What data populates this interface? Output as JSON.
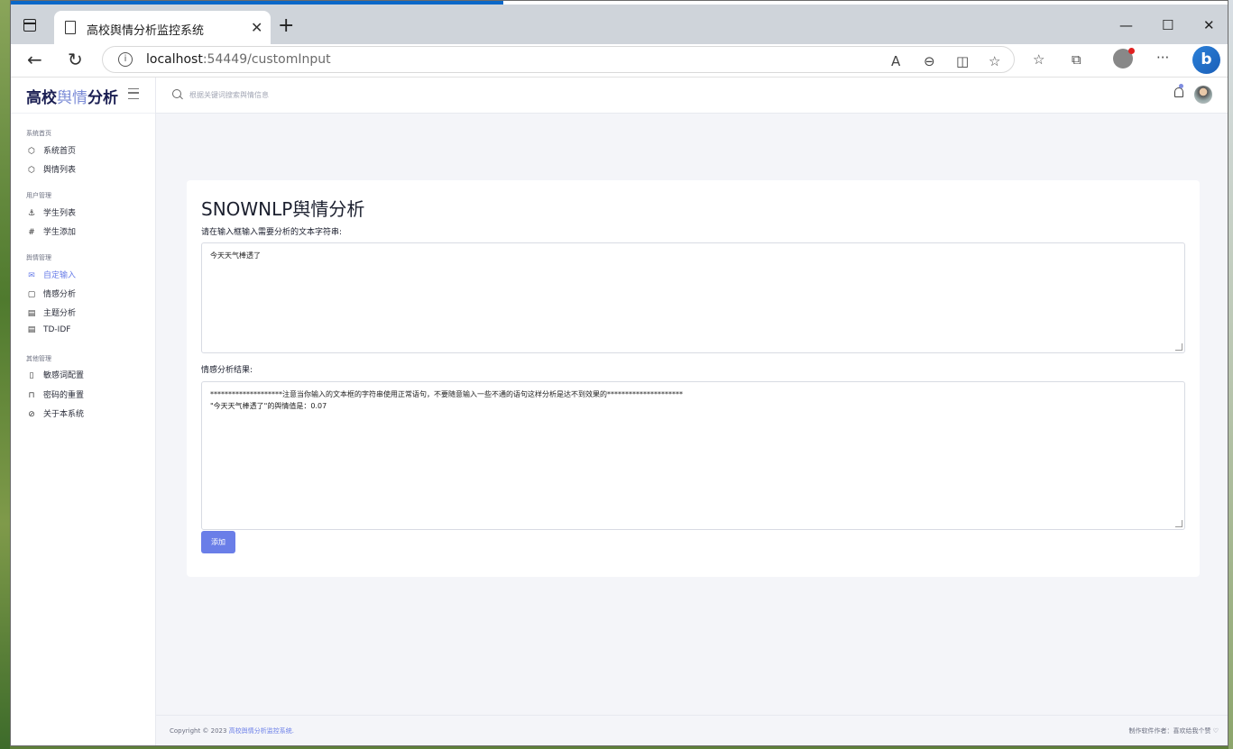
{
  "browser": {
    "tab_title": "高校舆情分析监控系统",
    "url_host": "localhost",
    "url_rest": ":54449/customInput"
  },
  "brand": {
    "part1": "高校",
    "part2": "舆情",
    "part3": "分析"
  },
  "search": {
    "placeholder": "根据关键词搜索舆情信息"
  },
  "sidebar": {
    "sections": [
      {
        "title": "系统首页",
        "items": [
          {
            "label": "系统首页",
            "icon": "cube-icon"
          },
          {
            "label": "舆情列表",
            "icon": "cube-icon"
          }
        ]
      },
      {
        "title": "用户管理",
        "items": [
          {
            "label": "学生列表",
            "icon": "anchor-icon"
          },
          {
            "label": "学生添加",
            "icon": "hash-icon"
          }
        ]
      },
      {
        "title": "舆情管理",
        "items": [
          {
            "label": "自定输入",
            "icon": "mail-icon",
            "active": true
          },
          {
            "label": "情感分析",
            "icon": "message-icon"
          },
          {
            "label": "主题分析",
            "icon": "calendar-icon"
          },
          {
            "label": "TD-IDF",
            "icon": "calendar-icon"
          }
        ]
      },
      {
        "title": "其他管理",
        "items": [
          {
            "label": "敏感词配置",
            "icon": "tablet-icon"
          },
          {
            "label": "密码的重置",
            "icon": "lock-icon"
          },
          {
            "label": "关于本系统",
            "icon": "eye-off-icon"
          }
        ]
      }
    ]
  },
  "main": {
    "title": "SNOWNLP舆情分析",
    "input_label": "请在输入框输入需要分析的文本字符串:",
    "input_value": "今天天气棒透了",
    "result_label": "情感分析结果:",
    "result_line1": "********************注意当你输入的文本框的字符串使用正常语句，不要随意输入一些不通的语句这样分析是达不到效果的*********************",
    "result_line2": "\"今天天气棒透了\"的舆情值是：0.07",
    "button_label": "添加"
  },
  "footer": {
    "copyright": "Copyright © 2023 ",
    "copyright_link": "高校舆情分析监控系统.",
    "right": "制作软件作者：喜欢给我个赞 ♡"
  },
  "colors": {
    "accent": "#6a7ee8",
    "brand_dark": "#1b1f53"
  }
}
